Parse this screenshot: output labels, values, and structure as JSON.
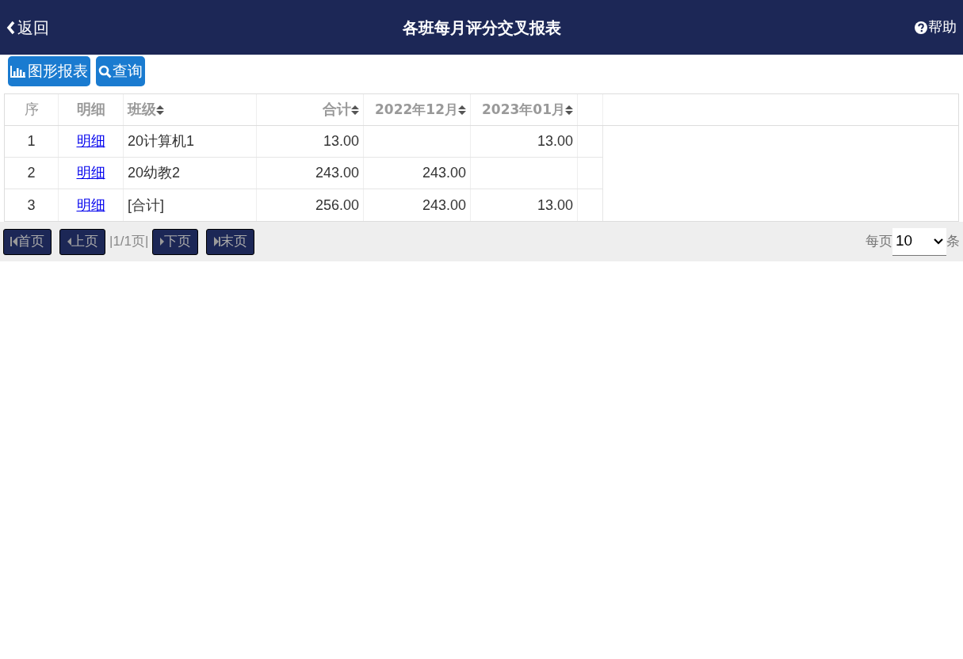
{
  "header": {
    "back": "返回",
    "title": "各班每月评分交叉报表",
    "help": "帮助"
  },
  "toolbar": [
    {
      "kind": "chart",
      "label": "图形报表"
    },
    {
      "kind": "search",
      "label": "查询"
    }
  ],
  "table": {
    "columns": [
      {
        "label": "序",
        "kind": "index",
        "sortable": false
      },
      {
        "label": "明细",
        "kind": "link",
        "sortable": false
      },
      {
        "label": "班级",
        "kind": "text",
        "sortable": true
      },
      {
        "label": "合计",
        "kind": "number",
        "sortable": true
      },
      {
        "label": "2022年12月",
        "kind": "number",
        "sortable": true
      },
      {
        "label": "2023年01月",
        "kind": "number",
        "sortable": true
      }
    ],
    "rows": [
      [
        "1",
        "明细",
        "20计算机1",
        "13.00",
        null,
        "13.00"
      ],
      [
        "2",
        "明细",
        "20幼教2",
        "243.00",
        "243.00",
        null
      ],
      [
        "3",
        "明细",
        "[合计]",
        "256.00",
        "243.00",
        "13.00"
      ]
    ]
  },
  "pager": {
    "buttons": [
      {
        "kind": "first",
        "label": "首页",
        "disabled": true
      },
      {
        "kind": "prev",
        "label": "上页",
        "disabled": true
      },
      {
        "kind": "info",
        "label": "|1/1页|"
      },
      {
        "kind": "next",
        "label": "下页",
        "disabled": true
      },
      {
        "kind": "last",
        "label": "末页",
        "disabled": true
      }
    ],
    "per_page_label": "每页",
    "per_page": "10",
    "per_page_unit": "条"
  }
}
